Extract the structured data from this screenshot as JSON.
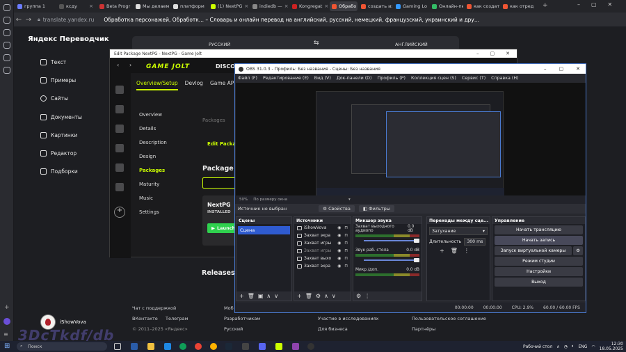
{
  "browser": {
    "tabs": [
      {
        "label": "группа 1",
        "color": "#6b7cff"
      },
      {
        "label": "ксду",
        "color": "#555"
      },
      {
        "label": "Beta Progr",
        "color": "#c33"
      },
      {
        "label": "Мы делаем",
        "color": "#fff"
      },
      {
        "label": "платформ",
        "color": "#fff"
      },
      {
        "label": "(1) NextPG",
        "color": "#ccff00"
      },
      {
        "label": "indiedb —",
        "color": "#888"
      },
      {
        "label": "Kongregat",
        "color": "#c22"
      },
      {
        "label": "Обрабо",
        "color": "#e53",
        "active": true
      },
      {
        "label": "создать из",
        "color": "#e53"
      },
      {
        "label": "Gaming Lo",
        "color": "#39f"
      },
      {
        "label": "Онлайн-пе",
        "color": "#3b6"
      },
      {
        "label": "как создат",
        "color": "#e53"
      },
      {
        "label": "как отред",
        "color": "#e53"
      }
    ],
    "url_host": "translate.yandex.ru",
    "page_title": "Обработка персонажей, Обработк... – Словарь и онлайн перевод на английский, русский, немецкий, французский, украинский и дру..."
  },
  "translator": {
    "logo": "Яндекс Переводчик",
    "nav": [
      {
        "label": "Текст",
        "icon": "text-icon"
      },
      {
        "label": "Примеры",
        "icon": "examples-icon"
      },
      {
        "label": "Сайты",
        "icon": "globe-icon"
      },
      {
        "label": "Документы",
        "icon": "document-icon"
      },
      {
        "label": "Картинки",
        "icon": "image-icon"
      },
      {
        "label": "Редактор",
        "icon": "editor-icon"
      },
      {
        "label": "Подборки",
        "icon": "collections-icon"
      }
    ],
    "source_lang": "РУССКИЙ",
    "target_lang": "АНГЛИЙСКИЙ",
    "user_name": "iShowVova",
    "footer": {
      "support": "Чат с поддержкой",
      "vk": "ВКонтакте",
      "telegram": "Телеграм",
      "copyright": "© 2011–2025 «Яндекс»",
      "mob": "Моб",
      "developers": "Разработчикам",
      "language": "Русский",
      "research": "Участие в исследованиях",
      "business": "Для бизнеса",
      "agreement": "Пользовательское соглашение",
      "partners": "Партнёры"
    }
  },
  "gamejolt": {
    "title": "Edit Package NextPG - NextPG - Game Jolt",
    "logo": "GAME JOLT",
    "discover": "DISCOV",
    "tabs": [
      "Overview/Setup",
      "Devlog",
      "Game API"
    ],
    "side": [
      "Overview",
      "Details",
      "Description",
      "Design",
      "Packages",
      "Maturity",
      "Music",
      "Settings"
    ],
    "crumb": "Packages",
    "edit": "Edit Packa",
    "package_heading": "Package P",
    "card_name": "NextPG",
    "card_status": "INSTALLED",
    "launch": "Launch",
    "releases": "Releases"
  },
  "obs": {
    "title": "OBS 31.0.3 - Профиль: Без названия - Сцены: Без названия",
    "menu": [
      "Файл (F)",
      "Редактирование (E)",
      "Вид (V)",
      "Док-панели (D)",
      "Профиль (P)",
      "Коллекция сцен (S)",
      "Сервис (T)",
      "Справка (H)"
    ],
    "zoom": "50%",
    "fit": "По размеру окна",
    "no_source": "Источник не выбран",
    "properties": "Свойства",
    "filters": "Фильтры",
    "scenes_header": "Сцены",
    "scene": "Сцена",
    "sources_header": "Источники",
    "sources": [
      "iShowVova",
      "Захват экра",
      "Захват игры",
      "Захват игры",
      "Захват выхо",
      "Захват экра"
    ],
    "mixer_header": "Микшер звука",
    "mixer": [
      {
        "name": "Захват выходного аудиопо",
        "db": "0.0 dB"
      },
      {
        "name": "Звук раб. стола",
        "db": "0.0 dB"
      },
      {
        "name": "Микр./доп.",
        "db": "0.0 dB"
      }
    ],
    "transitions_header": "Переходы между сце...",
    "transition": "Затухание",
    "duration_label": "Длительность",
    "duration": "300 ms",
    "controls_header": "Управление",
    "controls": [
      "Начать трансляцию",
      "Начать запись",
      "Запуск виртуальной камеры",
      "Режим студии",
      "Настройки",
      "Выход"
    ],
    "status_time": "00:00:00",
    "status_time2": "00:00:00",
    "cpu": "CPU: 2.9%",
    "fps": "60.00 / 60.00 FPS"
  },
  "taskbar": {
    "search": "Поиск",
    "desktop_label": "Рабочий стол",
    "lang": "ENG",
    "time": "12:30",
    "date": "18.05.2025"
  },
  "watermark": "3DcTkdf/db"
}
